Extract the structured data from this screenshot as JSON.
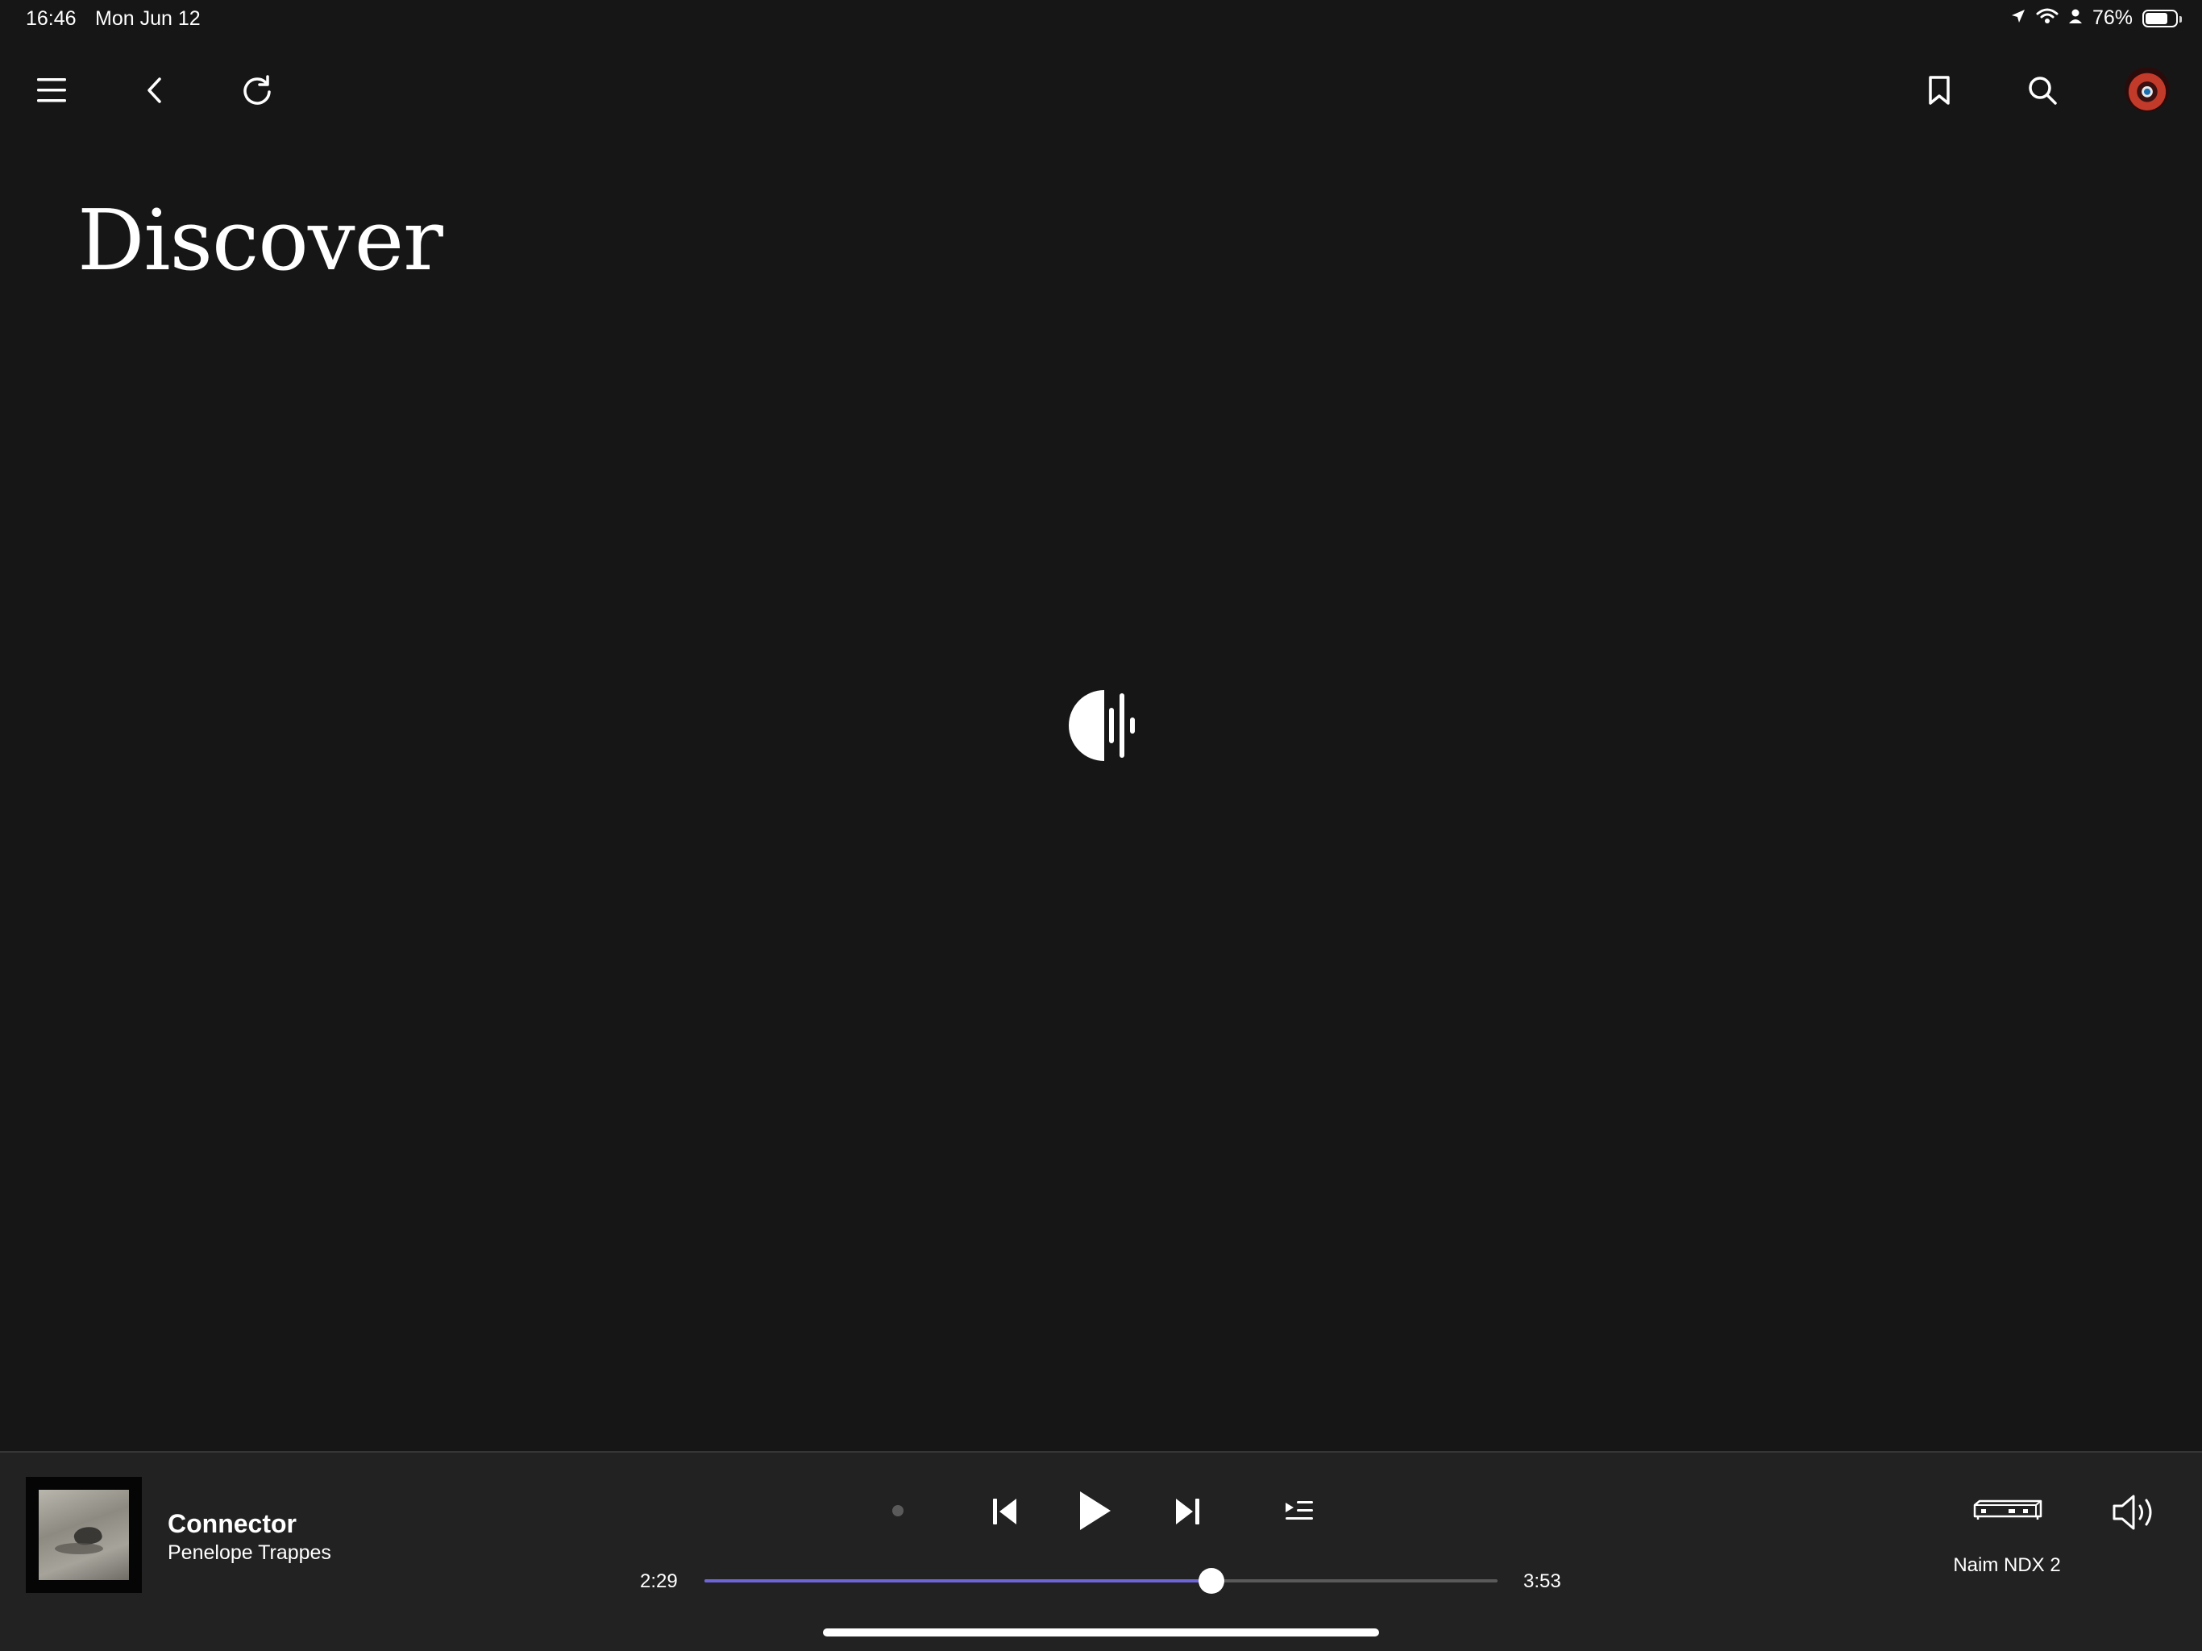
{
  "status_bar": {
    "time": "16:46",
    "date": "Mon Jun 12",
    "battery_percent": "76%",
    "battery_level": 0.76,
    "icons": [
      "location-arrow-icon",
      "wifi-icon",
      "person-icon",
      "battery-icon"
    ]
  },
  "nav": {
    "icons": [
      "menu-icon",
      "back-chevron-icon",
      "refresh-icon",
      "bookmark-icon",
      "search-icon",
      "avatar"
    ]
  },
  "page": {
    "title": "Discover",
    "loader_icon": "qobuz-loading-icon"
  },
  "player": {
    "track_title": "Connector",
    "track_artist": "Penelope Trappes",
    "elapsed": "2:29",
    "duration": "3:53",
    "progress": 0.6395,
    "device_name": "Naim NDX 2",
    "controls": [
      "shuffle-dot-icon",
      "previous-track-icon",
      "play-icon",
      "next-track-icon",
      "queue-icon",
      "streamer-device-icon",
      "volume-icon"
    ],
    "colors": {
      "progress_accent": "#6e66d8",
      "background": "#161616",
      "player_background": "#222222"
    }
  }
}
